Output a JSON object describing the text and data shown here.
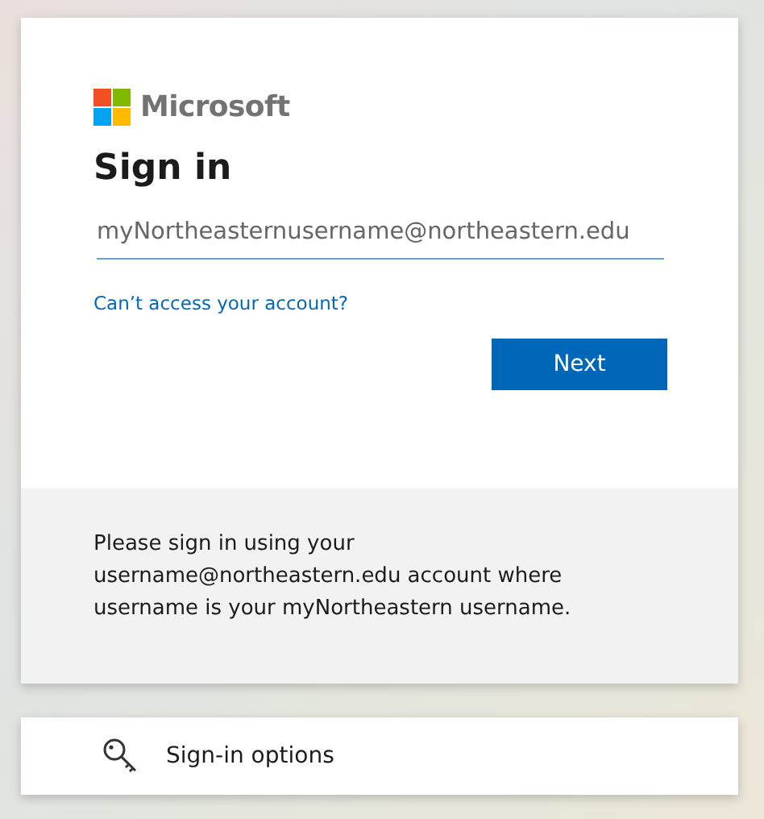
{
  "logo": {
    "text": "Microsoft"
  },
  "title": "Sign in",
  "email_field": {
    "placeholder": "myNortheasternusername@northeastern.edu"
  },
  "help_link": "Can’t access your account?",
  "buttons": [
    {
      "label": "Next",
      "kind": "primary"
    }
  ],
  "info": "Please sign in using your username@northeastern.edu account where username is your myNortheastern username.",
  "options": {
    "label": "Sign-in options"
  }
}
